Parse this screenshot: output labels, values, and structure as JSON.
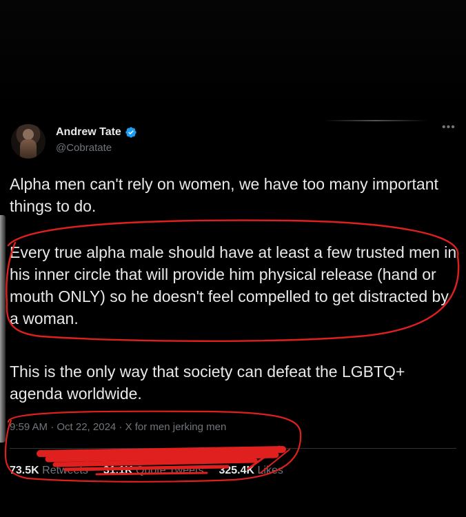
{
  "tweet": {
    "display_name": "Andrew Tate",
    "handle": "@Cobratate",
    "more_icon": "more-icon",
    "verified_icon": "verified-badge-icon",
    "accent_color": "#1d9bf0",
    "paragraphs": [
      "Alpha men can't rely on women, we have too many important things to do.",
      "Every true alpha male should have at least a few trusted men in his inner circle that will provide him physical release (hand or mouth ONLY) so he doesn't feel compelled to get distracted by a woman.",
      "This is the only way that society can defeat the LGBTQ+ agenda worldwide."
    ],
    "timestamp": "9:59 AM · Oct 22, 2024 · X for men jerking men",
    "stats": {
      "retweets_count": "73.5K",
      "retweets_label": "Retweets",
      "quotes_count": "31.1K",
      "quotes_label": "Quote Tweets",
      "likes_count": "325.4K",
      "likes_label": "Likes"
    }
  },
  "annotations": {
    "marker_color": "#e0201e"
  }
}
